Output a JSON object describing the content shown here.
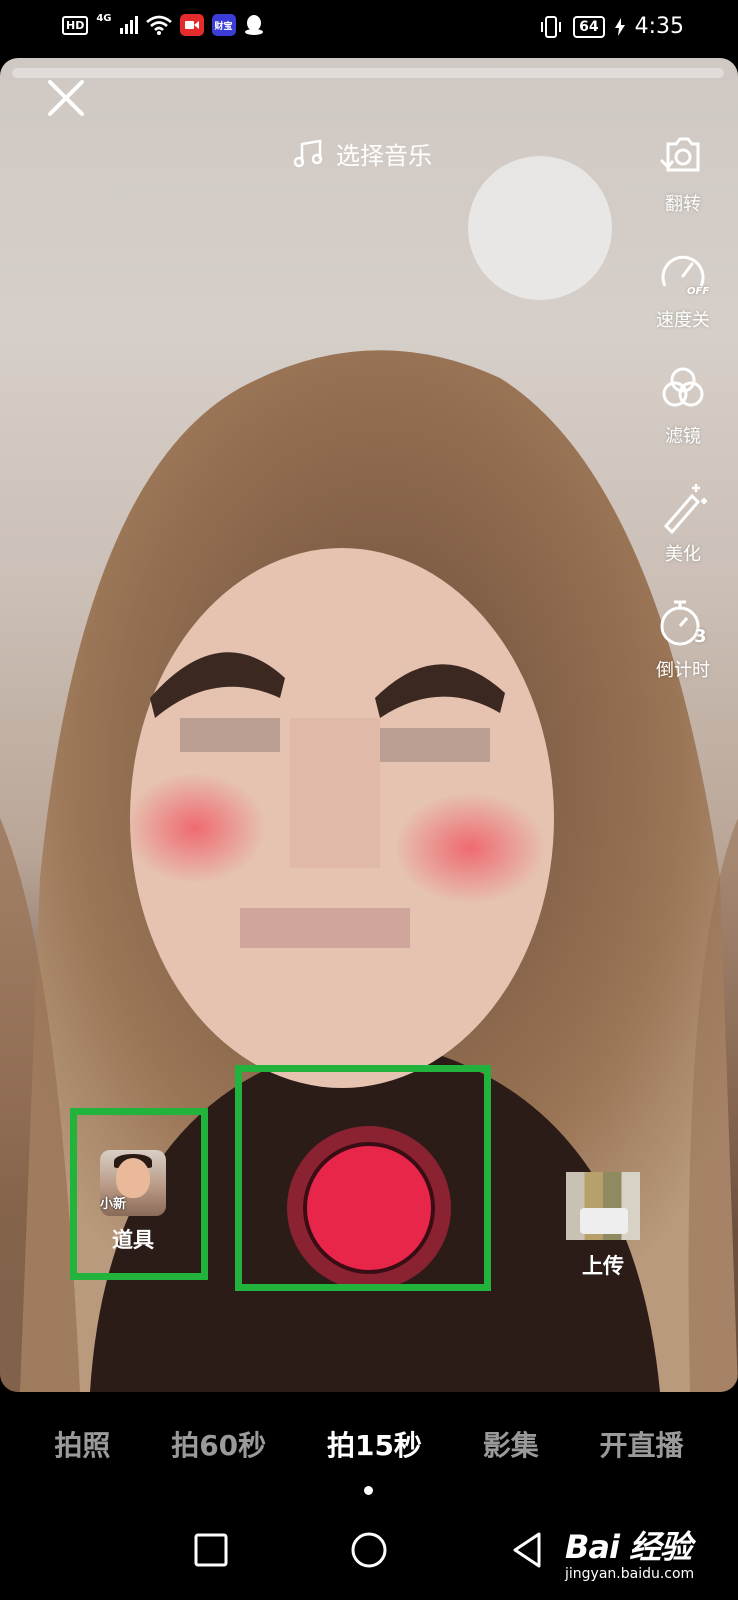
{
  "status_bar": {
    "hd": "HD",
    "network": "4G",
    "battery": "64",
    "time": "4:35",
    "app_icons": [
      {
        "name": "video-app-icon",
        "color": "#e52b2b",
        "text": ""
      },
      {
        "name": "finance-app-icon",
        "color": "#3c3cd6",
        "text": "财宝"
      },
      {
        "name": "qq-icon",
        "color": "",
        "text": ""
      }
    ]
  },
  "top": {
    "music_label": "选择音乐"
  },
  "side_tools": [
    {
      "label": "翻转",
      "icon": "flip-camera-icon"
    },
    {
      "label": "速度关",
      "icon": "speed-icon"
    },
    {
      "label": "滤镜",
      "icon": "filter-icon"
    },
    {
      "label": "美化",
      "icon": "beauty-wand-icon"
    },
    {
      "label": "倒计时",
      "icon": "countdown-timer-icon"
    }
  ],
  "speed_badge": "OFF",
  "countdown_badge": "3",
  "props": {
    "label": "道具",
    "thumb_text": "小新"
  },
  "upload": {
    "label": "上传"
  },
  "modes": [
    {
      "label": "拍照",
      "active": false
    },
    {
      "label": "拍60秒",
      "active": false
    },
    {
      "label": "拍15秒",
      "active": true
    },
    {
      "label": "影集",
      "active": false
    },
    {
      "label": "开直播",
      "active": false
    }
  ],
  "watermark": {
    "main": "Bai  经验",
    "sub": "jingyan.baidu.com"
  },
  "colors": {
    "record": "#e8264a",
    "highlight": "#22b33c"
  }
}
